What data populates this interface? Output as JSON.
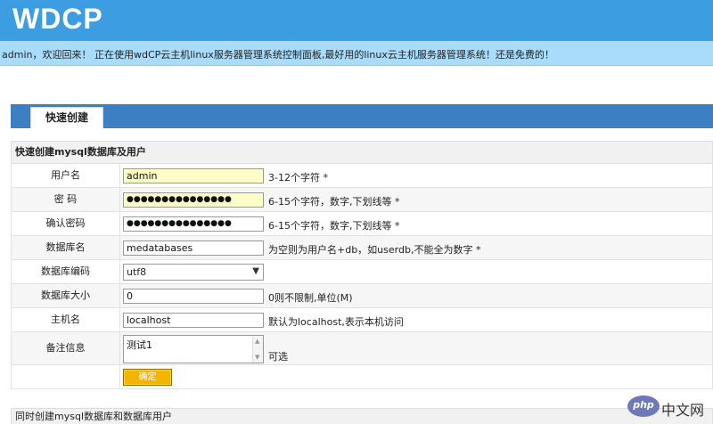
{
  "header": {
    "logo": "WDCP"
  },
  "welcome": {
    "text": "admin，欢迎回来！ 正在使用wdCP云主机linux服务器管理系统控制面板,最好用的linux云主机服务器管理系统！还是免费的！"
  },
  "tabs": [
    {
      "label": "快速创建"
    }
  ],
  "panel": {
    "title": "快速创建mysql数据库及用户"
  },
  "form": {
    "username": {
      "label": "用户名",
      "value": "admin",
      "hint": "3-12个字符 *"
    },
    "password": {
      "label": "密 码",
      "value": "●●●●●●●●●●●●●●●",
      "hint": "6-15个字符，数字,下划线等 *"
    },
    "confirm_password": {
      "label": "确认密码",
      "value": "●●●●●●●●●●●●●●●",
      "hint": "6-15个字符，数字,下划线等 *"
    },
    "db_name": {
      "label": "数据库名",
      "value": "medatabases",
      "hint": "为空则为用户名+db，如userdb,不能全为数字 *"
    },
    "db_charset": {
      "label": "数据库编码",
      "value": "utf8"
    },
    "db_size": {
      "label": "数据库大小",
      "value": "0",
      "hint": "0则不限制,单位(M)"
    },
    "host": {
      "label": "主机名",
      "value": "localhost",
      "hint": "默认为localhost,表示本机访问"
    },
    "notes": {
      "label": "备注信息",
      "value": "测试1",
      "hint": "可选"
    },
    "submit_label": "确定"
  },
  "panel2": {
    "title": "同时创建mysql数据库和数据库用户"
  },
  "watermark": {
    "icon_text": "php",
    "text": "中文网"
  },
  "colors": {
    "header_bg": "#3c9ee0",
    "welcome_bg": "#a9dcfa",
    "tabbar_bg": "#3c7fc2",
    "submit_bg": "#f4b400",
    "input_highlight": "#fdfdc7"
  }
}
